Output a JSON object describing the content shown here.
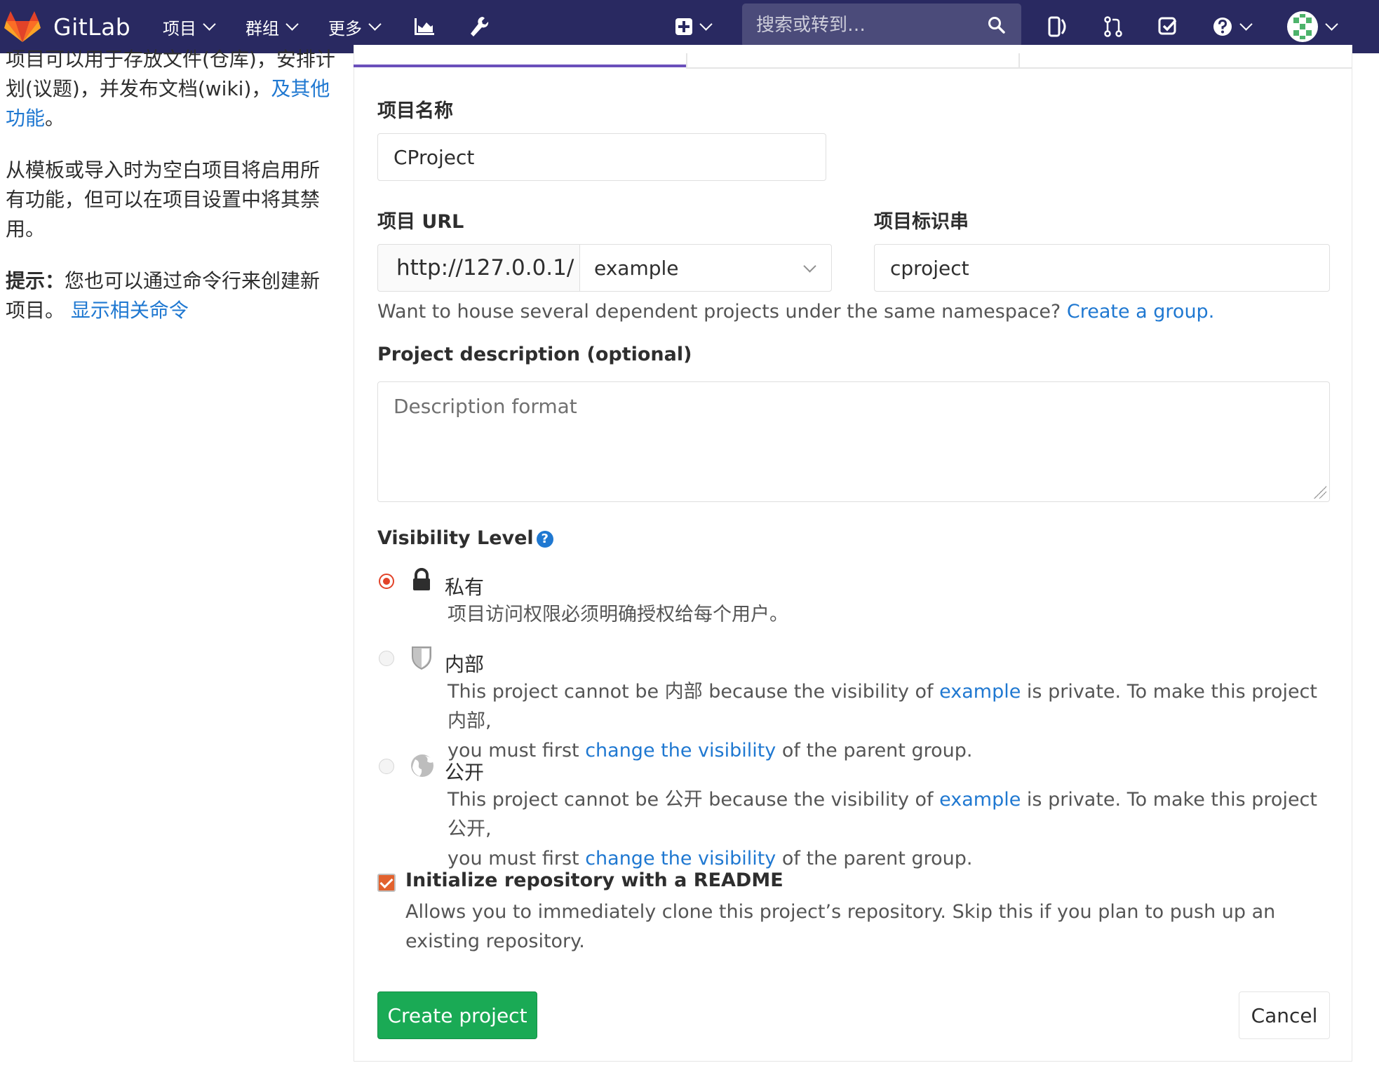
{
  "navbar": {
    "brand": "GitLab",
    "menu": [
      {
        "label": "项目"
      },
      {
        "label": "群组"
      },
      {
        "label": "更多"
      }
    ],
    "search_placeholder": "搜索或转到…",
    "colors": {
      "bg": "#292961",
      "logo": "#e24329"
    }
  },
  "sidebar": {
    "para1": {
      "text": "项目可以用于存放文件(仓库)，安排计划(议题)，并发布文档(wiki)，",
      "link": "及其他功能",
      "tail": "。"
    },
    "para2": "从模板或导入时为空白项目将启用所有功能，但可以在项目设置中将其禁用。",
    "tip": {
      "label": "提示：",
      "text": "您也可以通过命令行来创建新项目。",
      "link": "显示相关命令"
    }
  },
  "form": {
    "name_label": "项目名称",
    "name_value": "CProject",
    "url_label": "项目 URL",
    "url_prefix": "http://127.0.0.1/",
    "namespace": "example",
    "slug_label": "项目标识串",
    "slug_value": "cproject",
    "group_hint": {
      "text": "Want to house several dependent projects under the same namespace?",
      "link": "Create a group."
    },
    "desc_label": "Project description (optional)",
    "desc_placeholder": "Description format",
    "visibility_label": "Visibility Level",
    "visibility": [
      {
        "title": "私有",
        "desc": "项目访问权限必须明确授权给每个用户。",
        "checked": true
      },
      {
        "title": "内部",
        "desc_parts": [
          "This project cannot be 内部 because the visibility of ",
          "example",
          " is private. To make this project 内部,",
          "you must first ",
          "change the visibility",
          " of the parent group."
        ],
        "checked": false
      },
      {
        "title": "公开",
        "desc_parts": [
          "This project cannot be 公开 because the visibility of ",
          "example",
          " is private. To make this project 公开,",
          "you must first ",
          "change the visibility",
          " of the parent group."
        ],
        "checked": false
      }
    ],
    "readme": {
      "label": "Initialize repository with a README",
      "desc": "Allows you to immediately clone this project’s repository. Skip this if you plan to push up an existing repository.",
      "checked": true
    },
    "create_button": "Create project",
    "cancel_button": "Cancel"
  },
  "colors": {
    "link": "#1f78d1",
    "success": "#1aaa55",
    "accent": "#6b4fbb",
    "radio": "#e24329"
  }
}
